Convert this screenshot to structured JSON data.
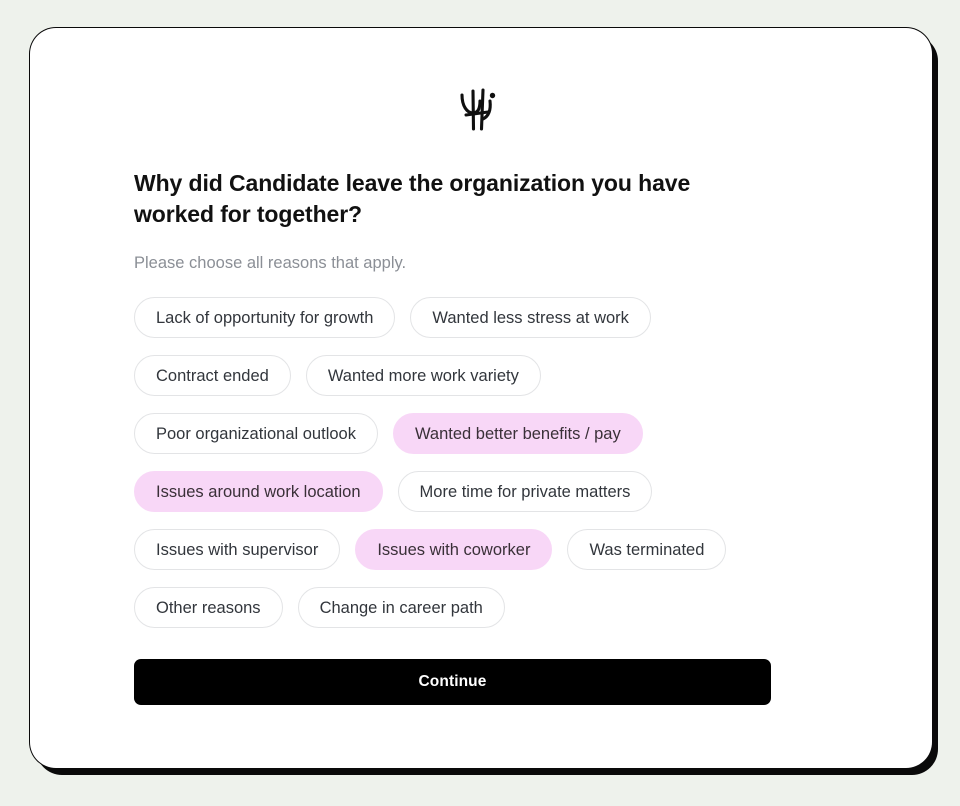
{
  "brand": {
    "logo_icon": "handwritten-hi-logo"
  },
  "survey": {
    "headline": "Why did Candidate leave the organization you have worked for together?",
    "subline": "Please choose all reasons that apply.",
    "options": [
      {
        "label": "Lack of opportunity for growth",
        "selected": false
      },
      {
        "label": "Wanted less stress at work",
        "selected": false
      },
      {
        "label": "Contract ended",
        "selected": false
      },
      {
        "label": "Wanted more work variety",
        "selected": false
      },
      {
        "label": "Poor organizational outlook",
        "selected": false
      },
      {
        "label": "Wanted better benefits / pay",
        "selected": true
      },
      {
        "label": "Issues around work location",
        "selected": true
      },
      {
        "label": "More time for private matters",
        "selected": false
      },
      {
        "label": "Issues with supervisor",
        "selected": false
      },
      {
        "label": "Issues with coworker",
        "selected": true
      },
      {
        "label": "Was terminated",
        "selected": false
      },
      {
        "label": "Other reasons",
        "selected": false
      },
      {
        "label": "Change in career path",
        "selected": false
      }
    ],
    "continue_label": "Continue"
  },
  "colors": {
    "page_background": "#eef2ec",
    "card_background": "#ffffff",
    "card_border": "#0a0a0a",
    "chip_border": "#e3e4e6",
    "chip_selected_background": "#f8d7f7",
    "text_primary": "#111111",
    "text_muted": "#8b8f96",
    "button_background": "#000000"
  }
}
